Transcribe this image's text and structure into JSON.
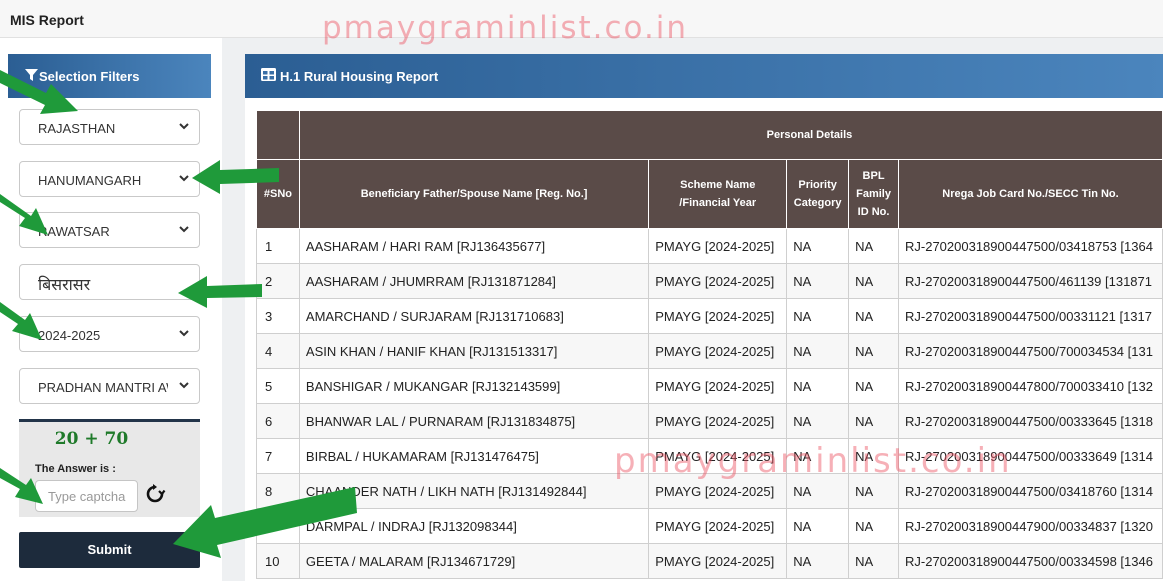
{
  "page_title": "MIS Report",
  "watermark": "pmaygraminlist.co.in",
  "sidebar": {
    "header": "Selection Filters",
    "header_icon": "filter-icon",
    "filters": [
      {
        "name": "state",
        "value": "RAJASTHAN"
      },
      {
        "name": "district",
        "value": "HANUMANGARH"
      },
      {
        "name": "block",
        "value": "RAWATSAR"
      },
      {
        "name": "village",
        "value": "बिसरासर"
      },
      {
        "name": "year",
        "value": "2024-2025"
      },
      {
        "name": "scheme",
        "value": "PRADHAN MANTRI AWAS YOJANA GRAMIN"
      }
    ],
    "captcha": {
      "question": "20 + 70",
      "answer_label": "The Answer is :",
      "placeholder": "Type captcha",
      "refresh_icon": "refresh-icon"
    },
    "submit_label": "Submit"
  },
  "report": {
    "header": "H.1 Rural Housing Report",
    "header_icon": "table-icon",
    "group_header": "Personal Details",
    "columns": [
      "#SNo",
      "Beneficiary Father/Spouse Name [Reg. No.]",
      "Scheme Name /Financial Year",
      "Priority Category",
      "BPL Family ID No.",
      "Nrega Job Card No./SECC Tin No."
    ],
    "rows": [
      [
        "1",
        "AASHARAM / HARI RAM [RJ136435677]",
        "PMAYG [2024-2025]",
        "NA",
        "NA",
        "RJ-270200318900447500/03418753 [1364"
      ],
      [
        "2",
        "AASHARAM / JHUMRRAM [RJ131871284]",
        "PMAYG [2024-2025]",
        "NA",
        "NA",
        "RJ-270200318900447500/461139 [131871"
      ],
      [
        "3",
        "AMARCHAND / SURJARAM [RJ131710683]",
        "PMAYG [2024-2025]",
        "NA",
        "NA",
        "RJ-270200318900447500/00331121 [1317"
      ],
      [
        "4",
        "ASIN KHAN / HANIF KHAN [RJ131513317]",
        "PMAYG [2024-2025]",
        "NA",
        "NA",
        "RJ-270200318900447500/700034534 [131"
      ],
      [
        "5",
        "BANSHIGAR / MUKANGAR [RJ132143599]",
        "PMAYG [2024-2025]",
        "NA",
        "NA",
        "RJ-270200318900447800/700033410 [132"
      ],
      [
        "6",
        "BHANWAR LAL / PURNARAM [RJ131834875]",
        "PMAYG [2024-2025]",
        "NA",
        "NA",
        "RJ-270200318900447500/00333645 [1318"
      ],
      [
        "7",
        "BIRBAL / HUKAMARAM [RJ131476475]",
        "PMAYG [2024-2025]",
        "NA",
        "NA",
        "RJ-270200318900447500/00333649 [1314"
      ],
      [
        "8",
        "CHAANDER NATH / LIKH NATH [RJ131492844]",
        "PMAYG [2024-2025]",
        "NA",
        "NA",
        "RJ-270200318900447500/03418760 [1314"
      ],
      [
        "9",
        "DARMPAL / INDRAJ [RJ132098344]",
        "PMAYG [2024-2025]",
        "NA",
        "NA",
        "RJ-270200318900447900/00334837 [1320"
      ],
      [
        "10",
        "GEETA / MALARAM [RJ134671729]",
        "PMAYG [2024-2025]",
        "NA",
        "NA",
        "RJ-270200318900447500/00334598 [1346"
      ]
    ]
  },
  "colors": {
    "header_gradient_start": "#2b5e93",
    "header_gradient_end": "#4b85bd",
    "table_header": "#5a4b48",
    "submit_bg": "#1d2b3c",
    "arrow": "#1f9a3a",
    "watermark": "#eb505f"
  }
}
